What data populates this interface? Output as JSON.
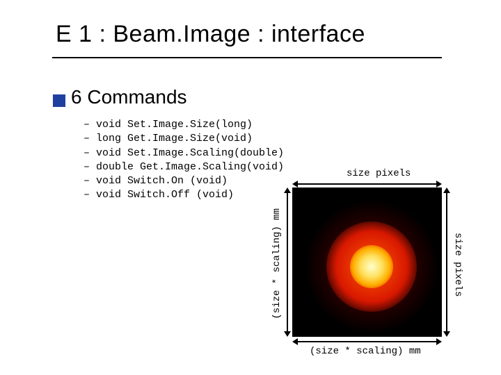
{
  "title": "E 1 : Beam.Image : interface",
  "subtitle": "6 Commands",
  "commands": [
    "void Set.Image.Size(long)",
    "long Get.Image.Size(void)",
    "void Set.Image.Scaling(double)",
    "double Get.Image.Scaling(void)",
    "void Switch.On (void)",
    "void Switch.Off (void)"
  ],
  "figure": {
    "top_label": "size pixels",
    "right_label": "size pixels",
    "left_label": "(size * scaling) mm",
    "bottom_label": "(size * scaling)  mm"
  }
}
